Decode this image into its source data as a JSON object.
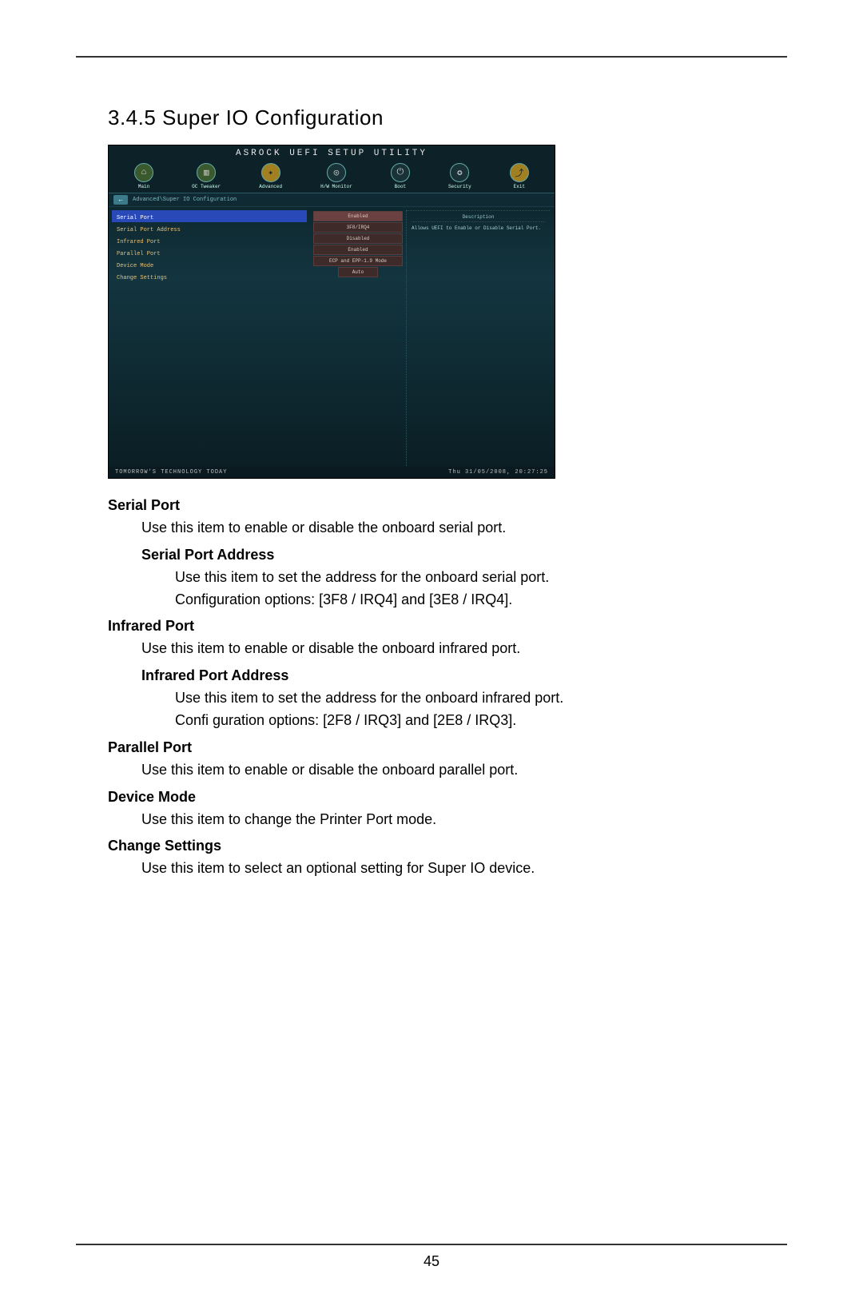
{
  "section_title": "3.4.5  Super IO Configuration",
  "page_number": "45",
  "bios": {
    "title": "ASROCK UEFI SETUP UTILITY",
    "nav": [
      {
        "label": "Main",
        "glyph": "⌂",
        "cls": "green"
      },
      {
        "label": "OC Tweaker",
        "glyph": "▥",
        "cls": "green"
      },
      {
        "label": "Advanced",
        "glyph": "✦",
        "cls": "yellow"
      },
      {
        "label": "H/W Monitor",
        "glyph": "◎",
        "cls": "dark"
      },
      {
        "label": "Boot",
        "glyph": "⏻",
        "cls": "dark"
      },
      {
        "label": "Security",
        "glyph": "✪",
        "cls": "dark"
      },
      {
        "label": "Exit",
        "glyph": "⤴",
        "cls": "yellow"
      }
    ],
    "breadcrumb": "Advanced\\Super IO Configuration",
    "settings": [
      {
        "label": "Serial Port",
        "value": "Enabled",
        "selected": true
      },
      {
        "label": "Serial Port Address",
        "value": "3F8/IRQ4"
      },
      {
        "label": "Infrared Port",
        "value": "Disabled"
      },
      {
        "label": "Parallel Port",
        "value": "Enabled"
      },
      {
        "label": "Device Mode",
        "value": "ECP and EPP-1.9 Mode"
      },
      {
        "label": "Change Settings",
        "value": "Auto",
        "small": true
      }
    ],
    "desc_header": "Description",
    "desc_text": "Allows UEFI to Enable or Disable Serial Port.",
    "footer_tagline": "TOMORROW'S TECHNOLOGY TODAY",
    "footer_time": "Thu 31/05/2008, 20:27:25"
  },
  "items": [
    {
      "heading": "Serial Port",
      "body": "Use this item to enable or disable the onboard serial port.",
      "sub": {
        "heading": "Serial Port Address",
        "body1": "Use this item to set the address for the onboard serial port.",
        "body2": "Configuration options: [3F8 / IRQ4] and [3E8 / IRQ4]."
      }
    },
    {
      "heading": "Infrared Port",
      "body": "Use this item to enable or disable the onboard infrared port.",
      "sub": {
        "heading": "Infrared Port Address",
        "body1": "Use this item to set the address for the onboard infrared port.",
        "body2": "Confi guration options: [2F8 / IRQ3] and [2E8 / IRQ3]."
      }
    },
    {
      "heading": "Parallel Port",
      "body": "Use this item to enable or disable the onboard parallel port."
    },
    {
      "heading": "Device Mode",
      "body": "Use this item to change the Printer Port mode."
    },
    {
      "heading": "Change Settings",
      "body": "Use this item to select an optional setting for Super IO device."
    }
  ]
}
